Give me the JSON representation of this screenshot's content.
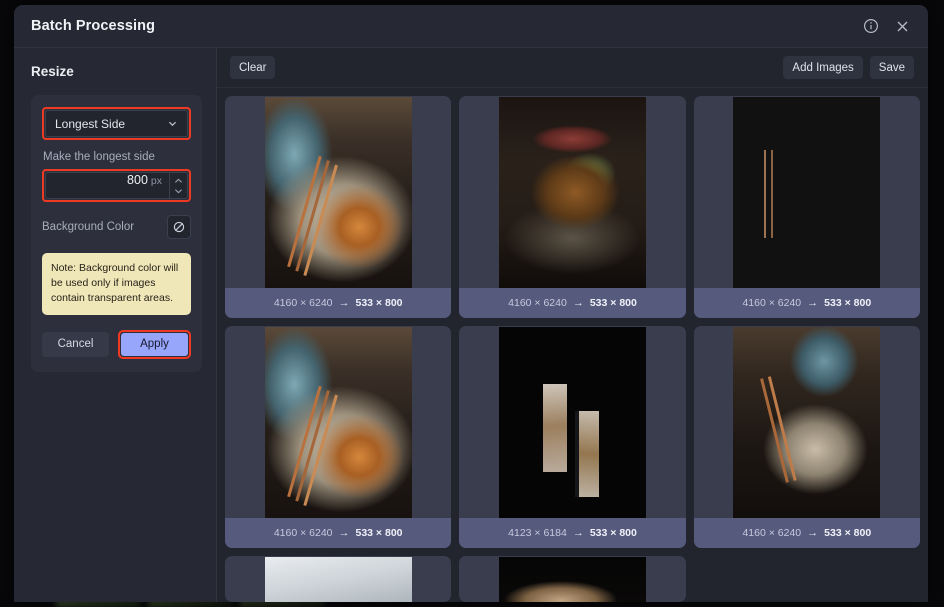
{
  "window": {
    "title": "Batch Processing",
    "info_icon": "info-circle-icon",
    "close_icon": "close-icon"
  },
  "sidebar": {
    "heading": "Resize",
    "mode_select": {
      "value": "Longest Side",
      "chevron_icon": "chevron-down-icon",
      "highlight_color": "#ef3a23"
    },
    "size_field": {
      "label": "Make the longest side",
      "value": "800",
      "unit": "px",
      "stepper_up_icon": "chevron-up-icon",
      "stepper_down_icon": "chevron-down-icon",
      "highlight_color": "#ef3a23"
    },
    "background_color": {
      "label": "Background Color",
      "swatch_icon": "no-color-slashed-circle-icon"
    },
    "note": "Note: Background color will be used only if images contain transparent areas.",
    "note_bg": "#f0e7b9",
    "cancel_label": "Cancel",
    "apply_label": "Apply",
    "apply_bg": "#97a5fb"
  },
  "toolbar": {
    "clear_label": "Clear",
    "add_images_label": "Add Images",
    "save_label": "Save"
  },
  "grid": {
    "arrow": "→",
    "items": [
      {
        "source": "4160 × 6240",
        "target": "533 × 800",
        "photo": "ph-a",
        "partial": false
      },
      {
        "source": "4160 × 6240",
        "target": "533 × 800",
        "photo": "ph-b",
        "partial": false
      },
      {
        "source": "4160 × 6240",
        "target": "533 × 800",
        "photo": "ph-c",
        "partial": false
      },
      {
        "source": "4160 × 6240",
        "target": "533 × 800",
        "photo": "ph-d",
        "partial": false
      },
      {
        "source": "4123 × 6184",
        "target": "533 × 800",
        "photo": "ph-e",
        "partial": false
      },
      {
        "source": "4160 × 6240",
        "target": "533 × 800",
        "photo": "ph-f",
        "partial": false
      },
      {
        "source": "",
        "target": "",
        "photo": "ph-g",
        "partial": true
      },
      {
        "source": "",
        "target": "",
        "photo": "ph-h",
        "partial": true
      }
    ]
  }
}
